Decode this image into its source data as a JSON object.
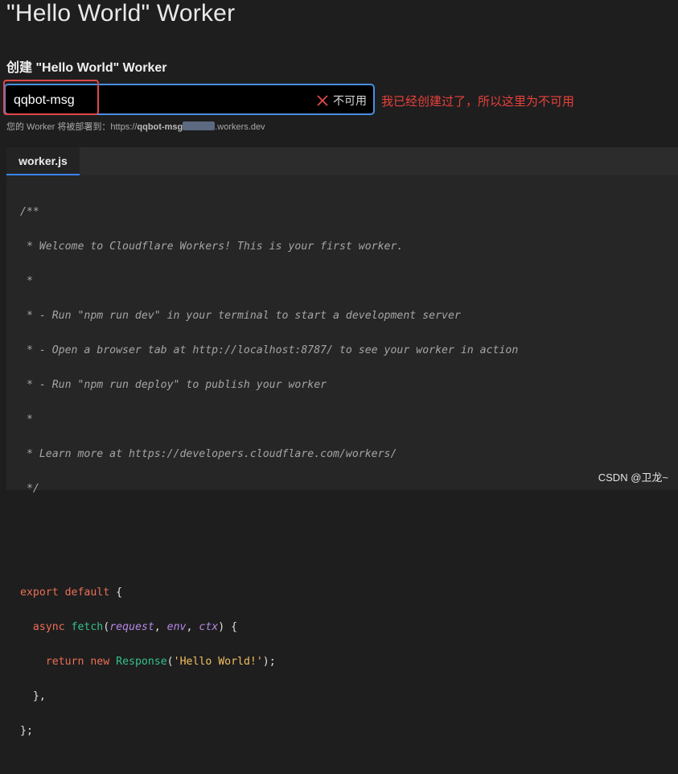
{
  "header": {
    "title": "\"Hello World\" Worker"
  },
  "form": {
    "section_label": "创建 \"Hello World\" Worker",
    "name_input_value": "qqbot-msg",
    "status_label": "不可用",
    "hint_prefix": "您的 Worker 将被部署到：https://",
    "hint_name": "qqbot-msg",
    "hint_suffix": ".workers.dev"
  },
  "annotation": {
    "text": "我已经创建过了，所以这里为不可用",
    "color": "#e8413a"
  },
  "editor": {
    "tab_label": "worker.js",
    "code": {
      "l1": "/**",
      "l2": " * Welcome to Cloudflare Workers! This is your first worker.",
      "l3": " *",
      "l4": " * - Run \"npm run dev\" in your terminal to start a development server",
      "l5": " * - Open a browser tab at http://localhost:8787/ to see your worker in action",
      "l6": " * - Run \"npm run deploy\" to publish your worker",
      "l7": " *",
      "l8": " * Learn more at https://developers.cloudflare.com/workers/",
      "l9": " */",
      "kw_export": "export",
      "kw_default": "default",
      "brace_open": "{",
      "kw_async": "async",
      "fn_fetch": "fetch",
      "param_request": "request",
      "param_env": "env",
      "param_ctx": "ctx",
      "kw_return": "return",
      "kw_new": "new",
      "fn_response": "Response",
      "str_hello": "'Hello World!'",
      "close_method": "},",
      "close_object": "};"
    }
  },
  "watermark": {
    "text": "CSDN @卫龙~"
  },
  "colors": {
    "accent": "#3a86ff",
    "field_border": "#4a90e2",
    "highlight": "#e0484a",
    "invalid_x": "#e0484a"
  },
  "icons": {
    "invalid": "close-x-icon"
  }
}
